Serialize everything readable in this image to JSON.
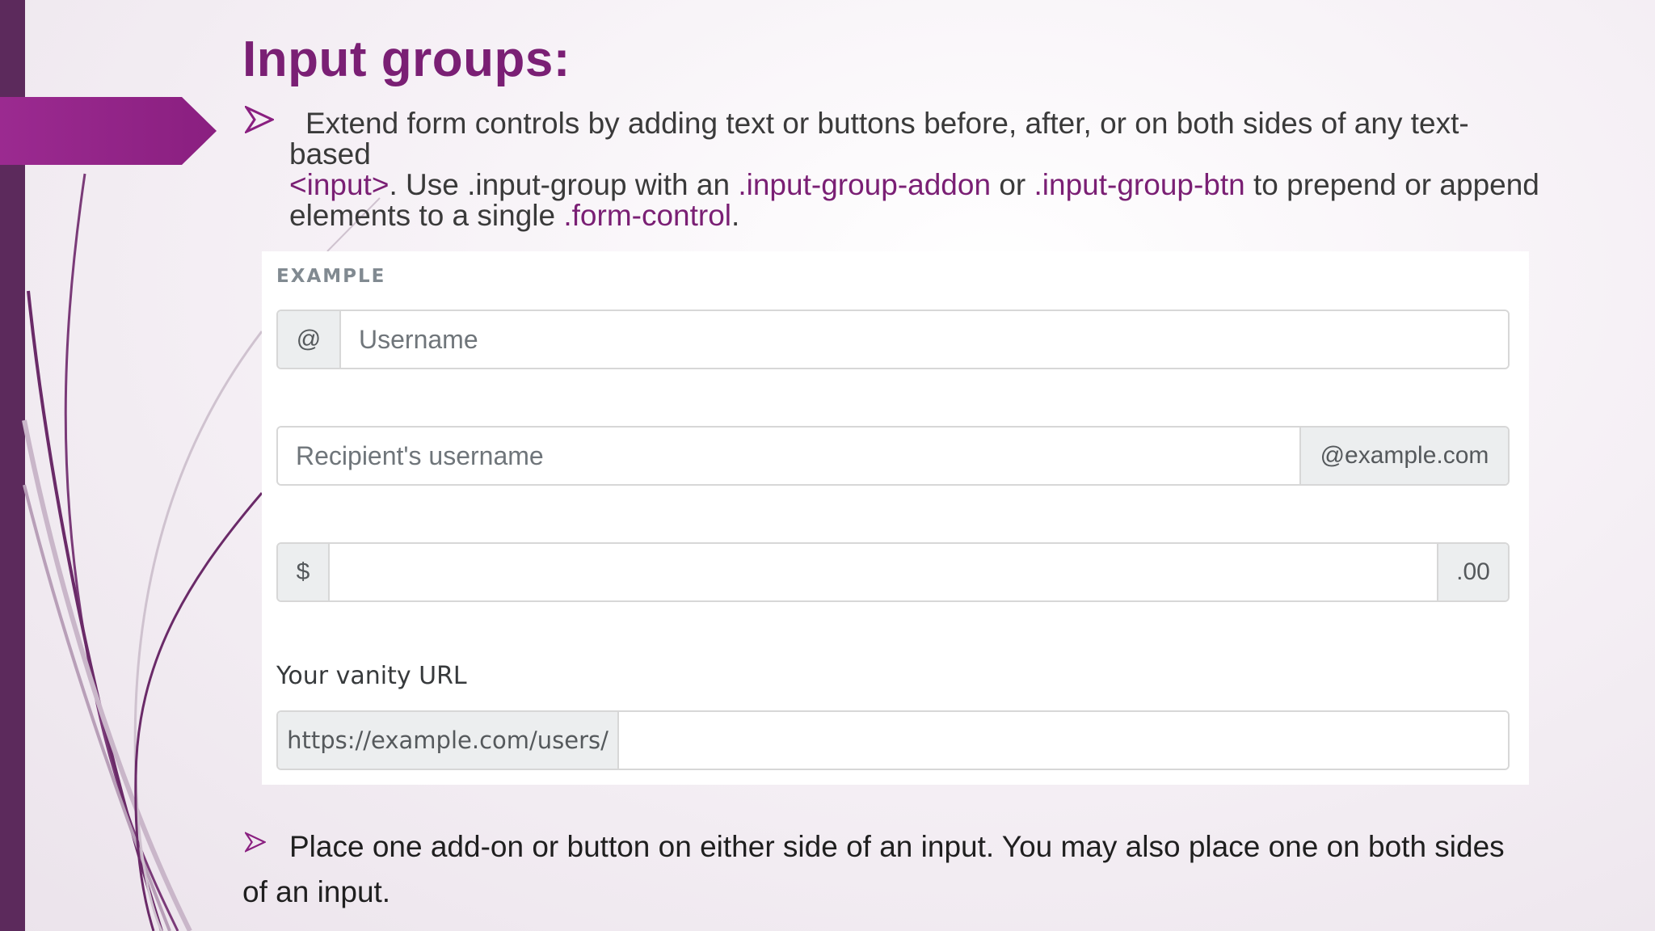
{
  "slide": {
    "title": "Input groups:",
    "accent_color": "#7a1f74"
  },
  "bullet1": {
    "icon": "arrow-bullet-icon",
    "t1": "Extend form controls by adding text or buttons before, after, or on both sides of any text-based",
    "code_input": "<input>",
    "t2": ". Use .input-group with an ",
    "code_addon": ".input-group-addon",
    "t3": " or ",
    "code_btn": ".input-group-btn",
    "t4": " to prepend or append elements to a single ",
    "code_formcontrol": ".form-control",
    "t5": "."
  },
  "example": {
    "label": "EXAMPLE",
    "group1": {
      "addon": "@",
      "placeholder": "Username"
    },
    "group2": {
      "placeholder": "Recipient's username",
      "addon": "@example.com"
    },
    "group3": {
      "addon_left": "$",
      "addon_right": ".00"
    },
    "group4": {
      "label": "Your vanity URL",
      "addon": "https://example.com/users/"
    }
  },
  "bullet2": {
    "icon": "arrow-bullet-icon",
    "text": "Place one add-on or button on either side of an input. You may also place one on both sides of an input."
  }
}
